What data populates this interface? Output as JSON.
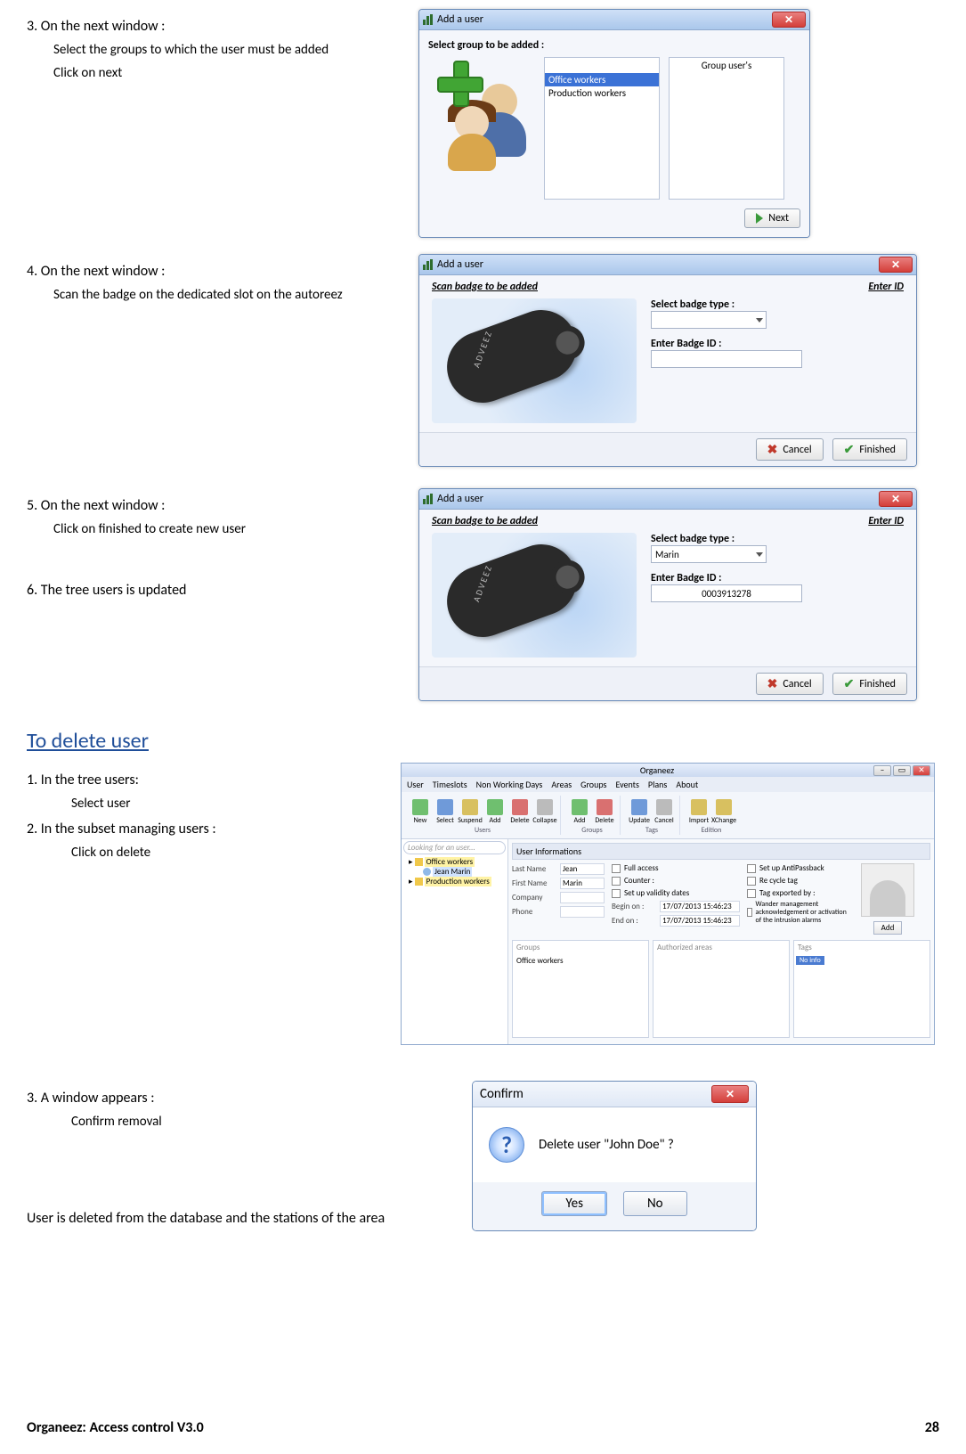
{
  "steps": {
    "s3": {
      "title": "3. On the next window :",
      "a": "Select the groups to which the user must be added",
      "b": "Click on next"
    },
    "s4": {
      "title": "4. On the next window :",
      "a": "Scan the badge on the dedicated slot on the autoreez"
    },
    "s5": {
      "title": "5. On the next window :",
      "a": "Click on finished to create new user"
    },
    "s6": "6. The tree users is updated",
    "section": "To delete user",
    "d1": {
      "title": "1. In the tree users:",
      "a": "Select user"
    },
    "d2": {
      "title": "2. In the subset managing users :",
      "a": "Click on delete"
    },
    "d3": {
      "title": "3. A window appears :",
      "a": "Confirm removal"
    },
    "outcome": "User is deleted from the database and the stations of the area"
  },
  "win_add": {
    "title": "Add a user",
    "group_prompt": "Select group to be added :",
    "col_right": "Group user's",
    "groups": [
      "Office workers",
      "Production workers"
    ],
    "next": "Next",
    "scan_hdr": "Scan badge to be added",
    "enter_hdr": "Enter ID",
    "badge_type_lbl": "Select badge type :",
    "badge_id_lbl": "Enter Badge ID :",
    "cancel": "Cancel",
    "finished": "Finished",
    "badge_brand": "ADVEEZ",
    "filled": {
      "type": "Marin",
      "id": "0003913278"
    }
  },
  "app": {
    "title": "Organeez",
    "menu": [
      "User",
      "Timeslots",
      "Non Working Days",
      "Areas",
      "Groups",
      "Events",
      "Plans",
      "About"
    ],
    "ribbon": {
      "users": {
        "label": "Users",
        "items": [
          "New",
          "Select",
          "Suspend",
          "Add",
          "Delete",
          "Collapse"
        ]
      },
      "groups": {
        "label": "Groups",
        "items": [
          "Add",
          "Delete"
        ]
      },
      "tags": {
        "label": "Tags",
        "items": [
          "Update",
          "Cancel"
        ]
      },
      "edition": {
        "label": "Edition",
        "items": [
          "Import",
          "XChange"
        ]
      }
    },
    "search_placeholder": "Looking for an user...",
    "tree": {
      "n1": "Office workers",
      "n1a": "Jean Marin",
      "n2": "Production workers"
    },
    "info": {
      "title": "User Informations",
      "last_name_lbl": "Last Name",
      "last_name": "Jean",
      "first_name_lbl": "First Name",
      "first_name": "Marin",
      "company_lbl": "Company",
      "phone_lbl": "Phone",
      "full_access": "Full access",
      "counter": "Counter :",
      "validity": "Set up validity dates",
      "begin_lbl": "Begin on :",
      "begin": "17/07/2013 15:46:23",
      "end_lbl": "End on :",
      "end": "17/07/2013 15:46:23",
      "antipassback": "Set up AntiPassback",
      "recycle": "Re cycle tag",
      "exported": "Tag exported by :",
      "wander": "Wander management acknowledgement or activation of the intrusion alarms",
      "add": "Add"
    },
    "panels": {
      "groups_lbl": "Groups",
      "groups_item": "Office workers",
      "areas_lbl": "Authorized areas",
      "tags_lbl": "Tags",
      "tags_item": "No info"
    }
  },
  "confirm": {
    "title": "Confirm",
    "msg": "Delete user \"John Doe\" ?",
    "yes": "Yes",
    "no": "No"
  },
  "footer": {
    "left": "Organeez: Access control     V3.0",
    "page": "28"
  }
}
